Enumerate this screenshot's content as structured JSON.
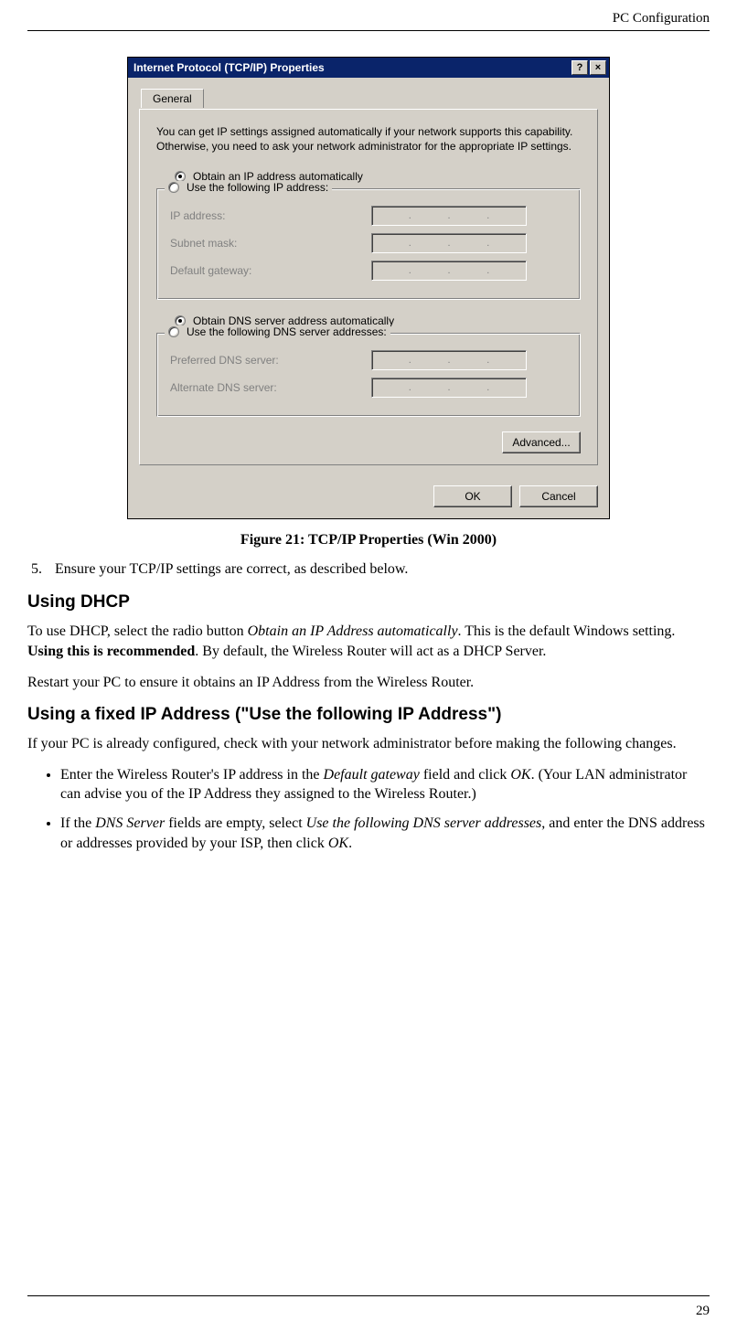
{
  "header": {
    "section": "PC Configuration"
  },
  "page_number": "29",
  "dialog": {
    "title": "Internet Protocol (TCP/IP) Properties",
    "help_btn": "?",
    "close_btn": "×",
    "tab": "General",
    "intro": "You can get IP settings assigned automatically if your network supports this capability. Otherwise, you need to ask your network administrator for the appropriate IP settings.",
    "radio_obtain_ip": "Obtain an IP address automatically",
    "radio_use_ip": "Use the following IP address:",
    "label_ip": "IP address:",
    "label_subnet": "Subnet mask:",
    "label_gateway": "Default gateway:",
    "radio_obtain_dns": "Obtain DNS server address automatically",
    "radio_use_dns": "Use the following DNS server addresses:",
    "label_pref_dns": "Preferred DNS server:",
    "label_alt_dns": "Alternate DNS server:",
    "btn_advanced": "Advanced...",
    "btn_ok": "OK",
    "btn_cancel": "Cancel"
  },
  "caption": "Figure 21: TCP/IP Properties (Win 2000)",
  "step5_num": "5.",
  "step5_text": "Ensure your TCP/IP settings are correct, as described below.",
  "h_dhcp": "Using DHCP",
  "p_dhcp_1a": "To use DHCP, select the radio button ",
  "p_dhcp_1b": "Obtain an IP Address automatically",
  "p_dhcp_1c": ". This is the default Windows setting. ",
  "p_dhcp_1d": "Using this is recommended",
  "p_dhcp_1e": ". By default, the Wireless Router will act as a DHCP Server.",
  "p_dhcp_2": "Restart your PC to ensure it obtains an IP Address from the Wireless Router.",
  "h_fixed": "Using a fixed IP Address (\"Use the following IP Address\")",
  "p_fixed": "If your PC is already configured, check with your network administrator before making the following changes.",
  "b1a": "Enter the Wireless Router's IP address in the ",
  "b1b": "Default gateway",
  "b1c": " field and click ",
  "b1d": "OK",
  "b1e": ". (Your LAN administrator can advise you of the IP Address they assigned to the Wireless Router.)",
  "b2a": "If the ",
  "b2b": "DNS Server",
  "b2c": " fields are empty, select ",
  "b2d": "Use the following DNS server addresses",
  "b2e": ", and enter the DNS address or addresses provided by your ISP, then click ",
  "b2f": "OK",
  "b2g": "."
}
